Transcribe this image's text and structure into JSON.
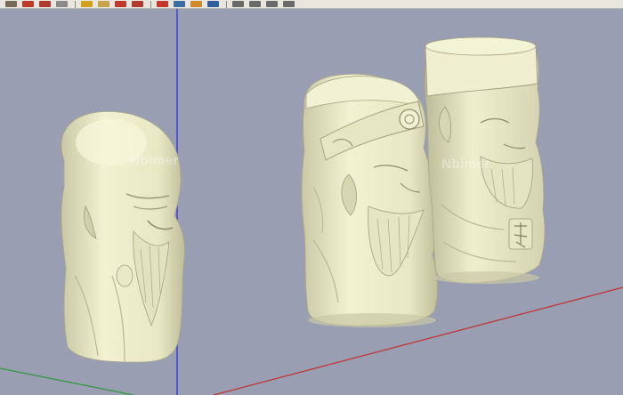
{
  "app": {
    "toolbar": {
      "buttons": [
        {
          "name": "box-icon",
          "color": "#7a6a55"
        },
        {
          "name": "pencil-icon",
          "color": "#c0392b"
        },
        {
          "name": "arc-icon",
          "color": "#b03a2e"
        },
        {
          "name": "eraser-icon",
          "color": "#8a8a8a"
        },
        {
          "name": "paint-bucket-icon",
          "color": "#d4a017"
        },
        {
          "name": "tape-measure-icon",
          "color": "#caa24a"
        },
        {
          "name": "rotate-icon",
          "color": "#c0392b"
        },
        {
          "name": "offset-icon",
          "color": "#b03a2e"
        },
        {
          "name": "move-icon",
          "color": "#c43a2a"
        },
        {
          "name": "orbit-icon",
          "color": "#3a6ea5"
        },
        {
          "name": "pan-icon",
          "color": "#d08a2a"
        },
        {
          "name": "zoom-icon",
          "color": "#2f5f9f"
        },
        {
          "name": "iso-view-icon",
          "color": "#6a6a6a"
        },
        {
          "name": "top-view-icon",
          "color": "#6a6a6a"
        },
        {
          "name": "front-view-icon",
          "color": "#6a6a6a"
        },
        {
          "name": "right-view-icon",
          "color": "#6a6a6a"
        }
      ]
    },
    "viewport": {
      "watermarks": [
        {
          "text": "Nbimer",
          "color": "#ffffff"
        },
        {
          "text": "Nbimer",
          "color": "#ffffff"
        }
      ],
      "colors": {
        "background": "#9a9eb2",
        "model": "#eeeecb",
        "model_shadow": "#c9c9a6",
        "axis_blue": "#2b2bd6",
        "axis_red": "#c23030",
        "axis_green": "#2d9a3a"
      }
    }
  }
}
